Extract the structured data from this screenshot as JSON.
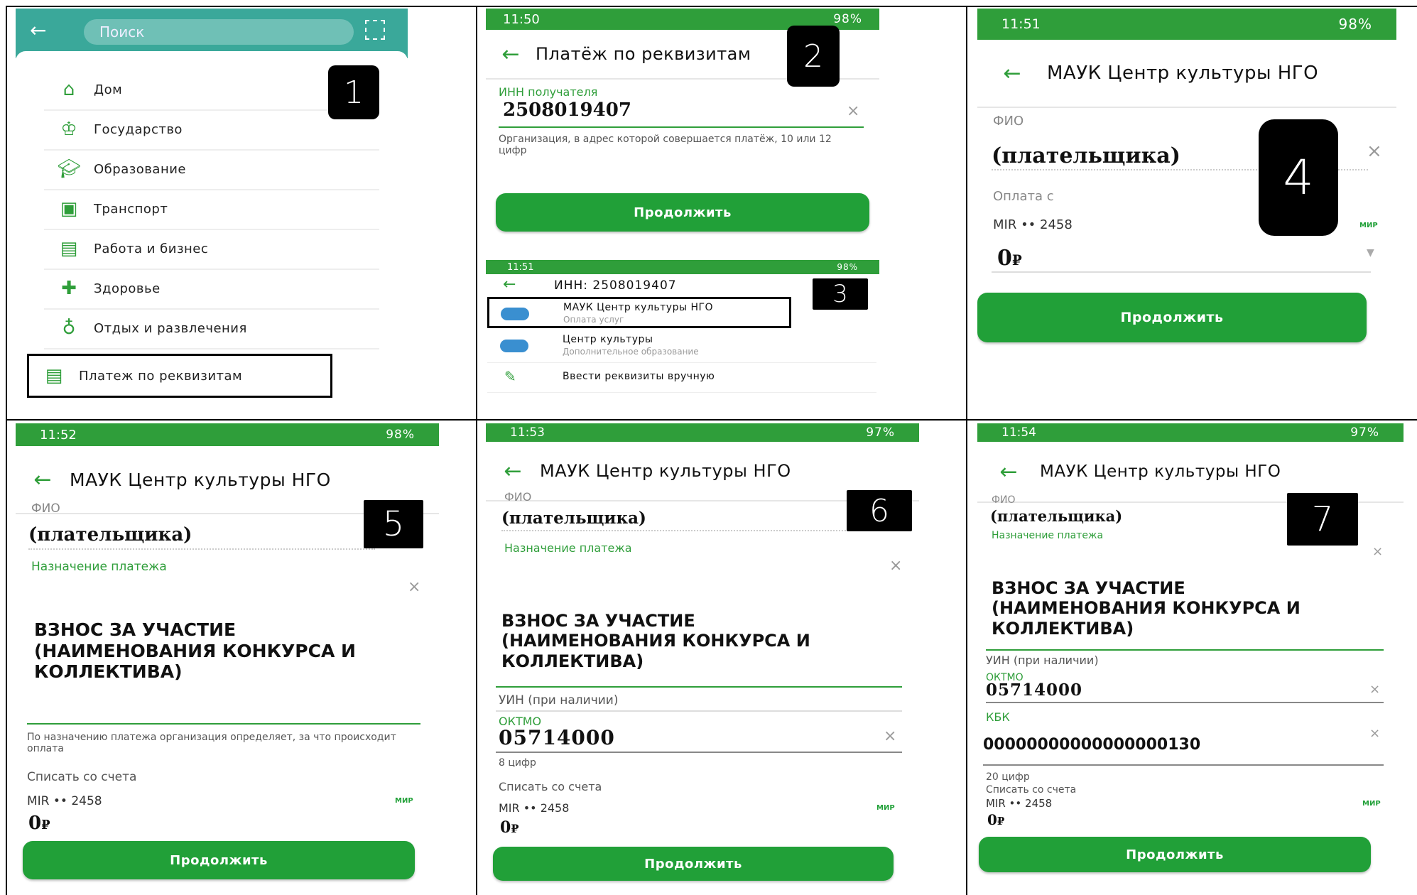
{
  "panel1": {
    "search_placeholder": "Поиск",
    "badge": "1",
    "items": [
      {
        "label": "Дом",
        "icon": "home-icon"
      },
      {
        "label": "Государство",
        "icon": "government-icon"
      },
      {
        "label": "Образование",
        "icon": "education-icon"
      },
      {
        "label": "Транспорт",
        "icon": "transport-icon"
      },
      {
        "label": "Работа и бизнес",
        "icon": "briefcase-icon"
      },
      {
        "label": "Здоровье",
        "icon": "health-icon"
      },
      {
        "label": "Отдых и развлечения",
        "icon": "leisure-icon"
      },
      {
        "label": "Платеж по реквизитам",
        "icon": "document-icon"
      }
    ]
  },
  "panel2": {
    "time": "11:50",
    "status_right": "98%",
    "title": "Платёж по реквизитам",
    "badge": "2",
    "inn_label": "ИНН получателя",
    "inn_value": "2508019407",
    "inn_hint": "Организация, в адрес которой совершается платёж, 10 или 12 цифр",
    "button": "Продолжить"
  },
  "panel3": {
    "time": "11:51",
    "status_right": "98%",
    "title": "ИНН: 2508019407",
    "badge": "3",
    "results": [
      {
        "title": "МАУК Центр культуры НГО",
        "sub": "Оплата услуг"
      },
      {
        "title": "Центр культуры",
        "sub": "Дополнительное образование"
      },
      {
        "title": "Ввести реквизиты вручную",
        "sub": ""
      }
    ]
  },
  "panel4": {
    "time": "11:51",
    "status_right": "98%",
    "title": "МАУК Центр культуры НГО",
    "badge": "4",
    "fio_label": "ФИО",
    "fio_value": "(плательщика)",
    "pay_from_label": "Оплата с",
    "card": "MIR •• 2458",
    "mir": "МИР",
    "amount": "0",
    "currency": "₽",
    "button": "Продолжить"
  },
  "panel5": {
    "time": "11:52",
    "status_right": "98%",
    "title": "МАУК Центр культуры НГО",
    "badge": "5",
    "fio_label": "ФИО",
    "fio_value": "(плательщика)",
    "purpose_label": "Назначение платежа",
    "purpose_value": "ВЗНОС ЗА УЧАСТИЕ (НАИМЕНОВАНИЯ КОНКУРСА И КОЛЛЕКТИВА)",
    "purpose_hint": "По назначению платежа организация определяет, за что происходит оплата",
    "account_label": "Списать со счета",
    "card": "MIR •• 2458",
    "mir": "МИР",
    "amount": "0",
    "currency": "₽",
    "button": "Продолжить"
  },
  "panel6": {
    "time": "11:53",
    "status_right": "97%",
    "title": "МАУК Центр культуры НГО",
    "badge": "6",
    "fio_label": "ФИО",
    "fio_value": "(плательщика)",
    "purpose_label": "Назначение платежа",
    "purpose_value": "ВЗНОС ЗА УЧАСТИЕ (НАИМЕНОВАНИЯ КОНКУРСА И КОЛЛЕКТИВА)",
    "uin_label": "УИН (при наличии)",
    "oktmo_label": "ОКТМО",
    "oktmo_value": "05714000",
    "oktmo_hint": "8 цифр",
    "account_label": "Списать со счета",
    "card": "MIR •• 2458",
    "mir": "МИР",
    "amount": "0",
    "currency": "₽",
    "button": "Продолжить"
  },
  "panel7": {
    "time": "11:54",
    "status_right": "97%",
    "title": "МАУК Центр культуры НГО",
    "badge": "7",
    "fio_label": "ФИО",
    "fio_value": "(плательщика)",
    "purpose_label": "Назначение платежа",
    "purpose_value": "ВЗНОС ЗА УЧАСТИЕ (НАИМЕНОВАНИЯ КОНКУРСА И КОЛЛЕКТИВА)",
    "uin_label": "УИН (при наличии)",
    "oktmo_label": "ОКТМО",
    "oktmo_value": "05714000",
    "kbk_label": "КБК",
    "kbk_value": "00000000000000000130",
    "kbk_hint": "20 цифр",
    "account_label": "Списать со счета",
    "card": "MIR •• 2458",
    "mir": "МИР",
    "amount": "0",
    "currency": "₽",
    "button": "Продолжить"
  }
}
